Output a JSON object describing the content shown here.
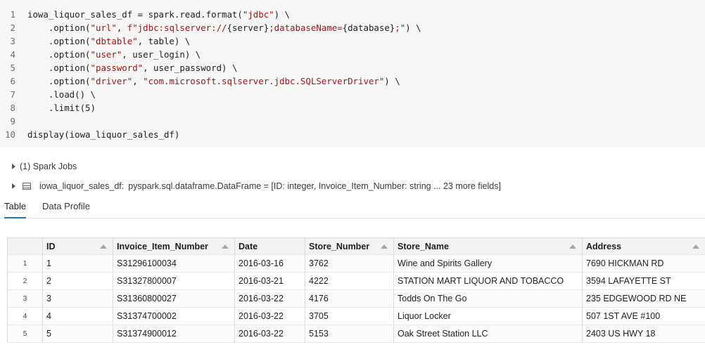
{
  "code_cell": {
    "lines": [
      {
        "n": "1",
        "segs": [
          {
            "t": "iowa_liquor_sales_df = spark.read.format(",
            "c": "fn"
          },
          {
            "t": "\"jdbc\"",
            "c": "str"
          },
          {
            "t": ") \\",
            "c": "fn"
          }
        ]
      },
      {
        "n": "2",
        "segs": [
          {
            "t": "    .option(",
            "c": "fn"
          },
          {
            "t": "\"url\"",
            "c": "str"
          },
          {
            "t": ", ",
            "c": "fn"
          },
          {
            "t": "f\"jdbc:sqlserver://",
            "c": "str"
          },
          {
            "t": "{server}",
            "c": "fn"
          },
          {
            "t": ";databaseName=",
            "c": "str"
          },
          {
            "t": "{database}",
            "c": "fn"
          },
          {
            "t": ";\"",
            "c": "str"
          },
          {
            "t": ") \\",
            "c": "fn"
          }
        ]
      },
      {
        "n": "3",
        "segs": [
          {
            "t": "    .option(",
            "c": "fn"
          },
          {
            "t": "\"dbtable\"",
            "c": "str"
          },
          {
            "t": ", table) \\",
            "c": "fn"
          }
        ]
      },
      {
        "n": "4",
        "segs": [
          {
            "t": "    .option(",
            "c": "fn"
          },
          {
            "t": "\"user\"",
            "c": "str"
          },
          {
            "t": ", user_login) \\",
            "c": "fn"
          }
        ]
      },
      {
        "n": "5",
        "segs": [
          {
            "t": "    .option(",
            "c": "fn"
          },
          {
            "t": "\"password\"",
            "c": "str"
          },
          {
            "t": ", user_password) \\",
            "c": "fn"
          }
        ]
      },
      {
        "n": "6",
        "segs": [
          {
            "t": "    .option(",
            "c": "fn"
          },
          {
            "t": "\"driver\"",
            "c": "str"
          },
          {
            "t": ", ",
            "c": "fn"
          },
          {
            "t": "\"com.microsoft.sqlserver.jdbc.SQLServerDriver\"",
            "c": "str"
          },
          {
            "t": ") \\",
            "c": "fn"
          }
        ]
      },
      {
        "n": "7",
        "segs": [
          {
            "t": "    .load() \\",
            "c": "fn"
          }
        ]
      },
      {
        "n": "8",
        "segs": [
          {
            "t": "    .limit(5)",
            "c": "fn"
          }
        ]
      },
      {
        "n": "9",
        "segs": []
      },
      {
        "n": "10",
        "segs": [
          {
            "t": "display(iowa_liquor_sales_df)",
            "c": "fn"
          }
        ]
      }
    ]
  },
  "output": {
    "spark_jobs": "(1) Spark Jobs",
    "df_name": "iowa_liquor_sales_df:",
    "df_type": "pyspark.sql.dataframe.DataFrame = [ID: integer, Invoice_Item_Number: string ... 23 more fields]"
  },
  "tabs": [
    {
      "label": "Table",
      "active": true
    },
    {
      "label": "Data Profile",
      "active": false
    }
  ],
  "table": {
    "columns": [
      "ID",
      "Invoice_Item_Number",
      "Date",
      "Store_Number",
      "Store_Name",
      "Address"
    ],
    "rows": [
      {
        "num": "1",
        "cells": [
          "1",
          "S31296100034",
          "2016-03-16",
          "3762",
          "Wine and Spirits Gallery",
          "7690 HICKMAN RD"
        ]
      },
      {
        "num": "2",
        "cells": [
          "2",
          "S31327800007",
          "2016-03-21",
          "4222",
          "STATION MART LIQUOR AND TOBACCO",
          "3594 LAFAYETTE ST"
        ]
      },
      {
        "num": "3",
        "cells": [
          "3",
          "S31360800027",
          "2016-03-22",
          "4176",
          "Todds On The Go",
          "235 EDGEWOOD RD NE"
        ]
      },
      {
        "num": "4",
        "cells": [
          "4",
          "S31374700002",
          "2016-03-22",
          "3705",
          "Liquor Locker",
          "507 1ST AVE #100"
        ]
      },
      {
        "num": "5",
        "cells": [
          "5",
          "S31374900012",
          "2016-03-22",
          "5153",
          "Oak Street Station LLC",
          "2403 US HWY 18"
        ]
      }
    ]
  },
  "colors": {
    "accent": "#1f77b4",
    "string": "#a31515",
    "code_bg": "#f6f6f6"
  }
}
